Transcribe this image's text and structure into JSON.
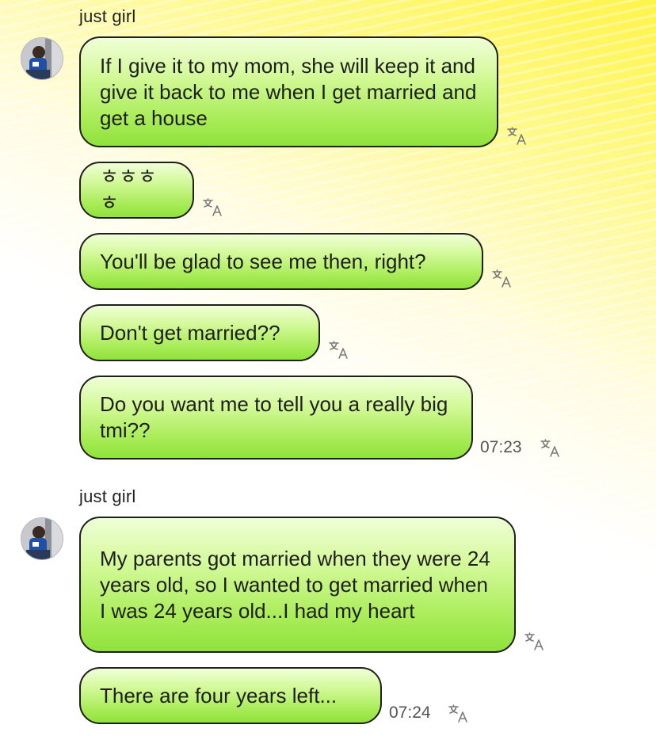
{
  "groups": [
    {
      "sender": "just girl",
      "messages": [
        "If I give it to my mom, she will keep it and give it back to me when I get married and get a house",
        "ㅎㅎㅎㅎ",
        "You'll be glad to see me then, right?",
        "Don't get married??",
        "Do you want me to tell you a really big tmi??"
      ],
      "timestamp": "07:23"
    },
    {
      "sender": "just girl",
      "messages": [
        "My parents got married when they were 24 years old, so I wanted to get married when I was 24 years old...I had my heart",
        "There are four years left..."
      ],
      "timestamp": "07:24"
    }
  ],
  "icons": {
    "translate": "translate-icon",
    "avatar": "avatar"
  },
  "colors": {
    "bubble_top": "#f0ffd8",
    "bubble_bottom": "#8fe23c",
    "bubble_border": "#1f1f1f",
    "background_accent": "#fff44a"
  }
}
